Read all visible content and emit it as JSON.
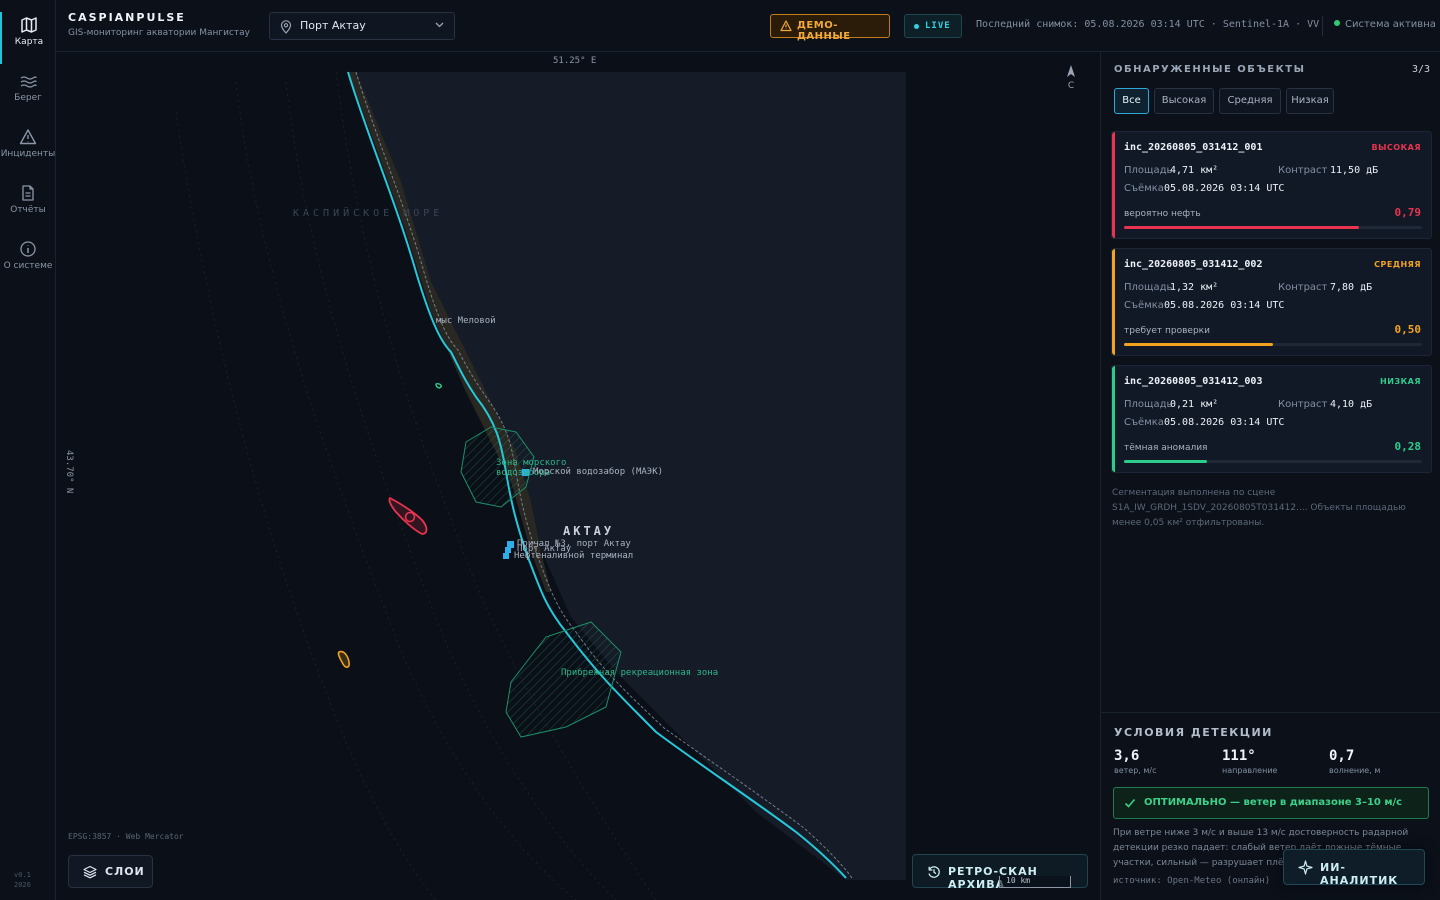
{
  "rail": {
    "items": [
      {
        "label": "Карта",
        "icon": "map-icon"
      },
      {
        "label": "Берег",
        "icon": "waves-icon"
      },
      {
        "label": "Инциденты",
        "icon": "warning-icon"
      },
      {
        "label": "Отчёты",
        "icon": "document-icon"
      },
      {
        "label": "О системе",
        "icon": "info-icon"
      }
    ],
    "version": "v0.1",
    "year": "2026"
  },
  "header": {
    "title": "CASPIANPULSE",
    "subtitle": "GIS-мониторинг акватории Мангистау",
    "location": "Порт Актау",
    "demo_badge": "ДЕМО-ДАННЫЕ",
    "live_badge": "LIVE",
    "snapshot": "Последний снимок: 05.08.2026 03:14 UTC · Sentinel-1A · VV",
    "system_status": "Система активна"
  },
  "map": {
    "lon_label": "51.25° E",
    "lat_label": "43.70° N",
    "north_label": "С",
    "sea_label": "КАСПИЙСКОЕ МОРЕ",
    "cape_label": "мыс Меловой",
    "city_label": "АКТАУ",
    "poi": [
      "Морской водозабор (МАЭК)",
      "Причал №3, порт Актау",
      "Порт Актау",
      "Нефтеналивной терминал"
    ],
    "zones": [
      "Зона морского водозабора",
      "Прибрежная рекреационная зона"
    ],
    "projection": "EPSG:3857 · Web Mercator",
    "scale_label": "10 km",
    "layers_button": "СЛОИ",
    "retro_button": "РЕТРО-СКАН АРХИВА",
    "colors": {
      "coast": "#25c9dc",
      "zone": "#1e8f68",
      "high": "#e8344e",
      "medium": "#f2a320",
      "low": "#2ecc8a",
      "poi": "#2eaee8"
    }
  },
  "panel": {
    "title": "ОБНАРУЖЕННЫЕ ОБЪЕКТЫ",
    "count": "3/3",
    "filters": [
      "Все",
      "Высокая",
      "Средняя",
      "Низкая"
    ],
    "area_label": "Площадь",
    "contrast_label": "Контраст",
    "time_label": "Съёмка",
    "incidents": [
      {
        "id": "inc_20260805_031412_001",
        "severity": "ВЫСОКАЯ",
        "color": "#e8344e",
        "area": "4,71 км²",
        "contrast": "11,50 дБ",
        "time": "05.08.2026 03:14 UTC",
        "class": "вероятно нефть",
        "score": "0,79",
        "score_value": 0.79
      },
      {
        "id": "inc_20260805_031412_002",
        "severity": "СРЕДНЯЯ",
        "color": "#f2a320",
        "area": "1,32 км²",
        "contrast": "7,80 дБ",
        "time": "05.08.2026 03:14 UTC",
        "class": "требует проверки",
        "score": "0,50",
        "score_value": 0.5
      },
      {
        "id": "inc_20260805_031412_003",
        "severity": "НИЗКАЯ",
        "color": "#2ecc8a",
        "area": "0,21 км²",
        "contrast": "4,10 дБ",
        "time": "05.08.2026 03:14 UTC",
        "class": "тёмная аномалия",
        "score": "0,28",
        "score_value": 0.28
      }
    ],
    "note": "Сегментация выполнена по сцене S1A_IW_GRDH_1SDV_20260805T031412.... Объекты площадью менее 0,05 км² отфильтрованы."
  },
  "conditions": {
    "title": "УСЛОВИЯ ДЕТЕКЦИИ",
    "wind": {
      "value": "3,6",
      "label": "ветер, м/с"
    },
    "direction": {
      "value": "111°",
      "label": "направление"
    },
    "waves": {
      "value": "0,7",
      "label": "волнение, м"
    },
    "status": "ОПТИМАЛЬНО — ветер в диапазоне 3–10 м/с",
    "description": "При ветре ниже 3 м/с и выше 13 м/с достоверность радарной детекции резко падает: слабый ветер даёт ложные тёмные участки, сильный — разрушает плёнку.",
    "source": "источник: Open-Meteo (онлайн)",
    "ai_button": "ИИ-АНАЛИТИК"
  }
}
